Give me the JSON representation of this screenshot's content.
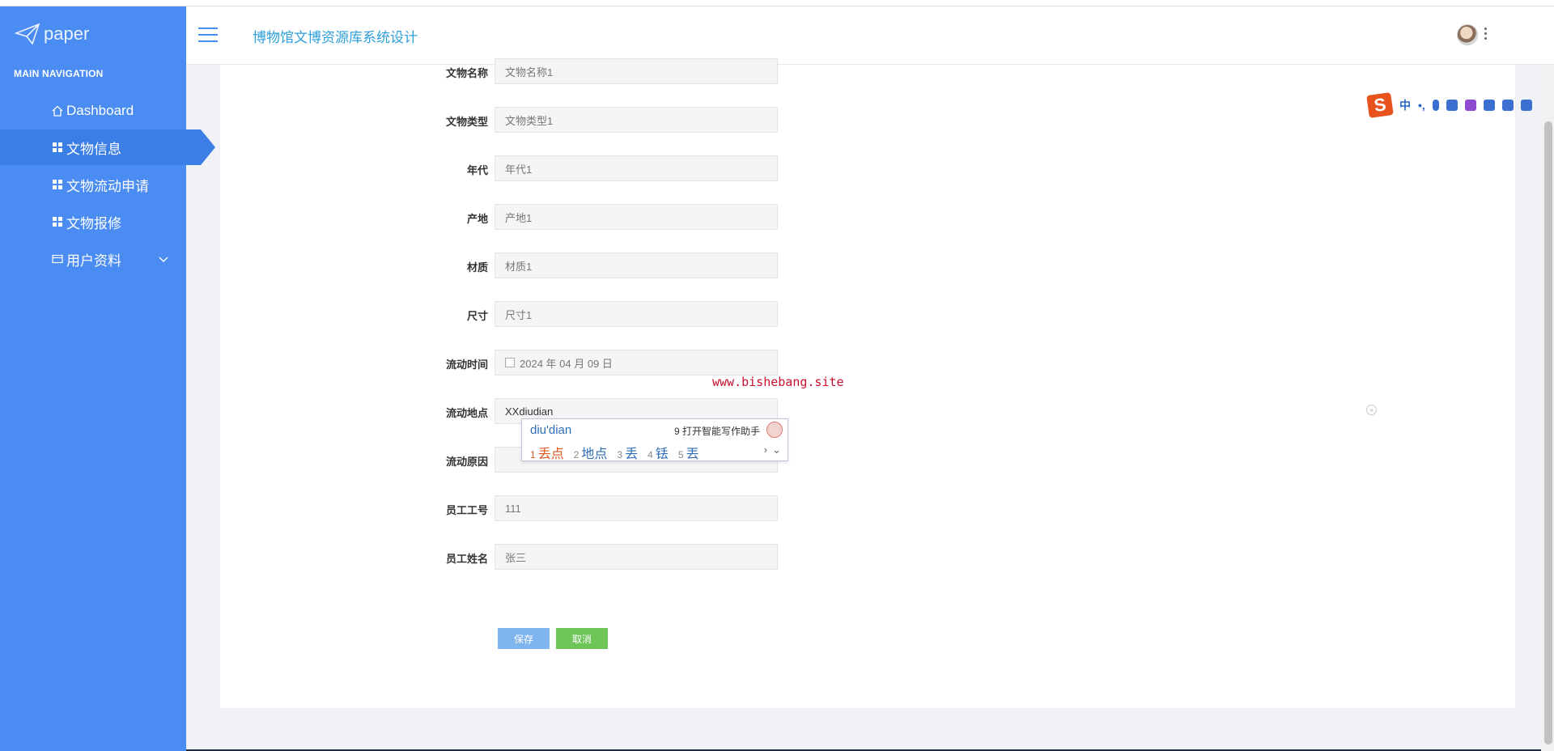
{
  "sidebar": {
    "brand": "paper",
    "heading": "MAIN NAVIGATION",
    "items": [
      {
        "label": "Dashboard",
        "icon": "home-icon"
      },
      {
        "label": "文物信息",
        "icon": "grid-icon",
        "active": true
      },
      {
        "label": "文物流动申请",
        "icon": "grid-icon"
      },
      {
        "label": "文物报修",
        "icon": "grid-icon"
      },
      {
        "label": "用户资料",
        "icon": "card-icon",
        "expandable": true
      }
    ]
  },
  "header": {
    "title": "博物馆文博资源库系统设计"
  },
  "form": {
    "fields": [
      {
        "label": "文物名称",
        "value": "文物名称1"
      },
      {
        "label": "文物类型",
        "value": "文物类型1"
      },
      {
        "label": "年代",
        "value": "年代1"
      },
      {
        "label": "产地",
        "value": "产地1"
      },
      {
        "label": "材质",
        "value": "材质1"
      },
      {
        "label": "尺寸",
        "value": "尺寸1"
      },
      {
        "label": "流动时间",
        "value": "2024 年 04 月 09 日"
      },
      {
        "label": "流动地点",
        "value": "XXdiudian"
      },
      {
        "label": "流动原因",
        "value": ""
      },
      {
        "label": "员工工号",
        "value": "111"
      },
      {
        "label": "员工姓名",
        "value": "张三"
      }
    ],
    "save_label": "保存",
    "cancel_label": "取消"
  },
  "watermark": "www.bishebang.site",
  "ime": {
    "pinyin": "diu'dian",
    "assist": "9 打开智能写作助手",
    "candidates": [
      {
        "n": "1",
        "text": "丢点"
      },
      {
        "n": "2",
        "text": "地点"
      },
      {
        "n": "3",
        "text": "丢"
      },
      {
        "n": "4",
        "text": "铥"
      },
      {
        "n": "5",
        "text": "丟"
      }
    ]
  },
  "sogou_toolbar": {
    "logo": "S",
    "mode": "中",
    "punct": "•,"
  },
  "colors": {
    "sidebar": "#4a8cf2",
    "sidebar_active": "#3b7ee6",
    "title": "#2d9fd9",
    "save": "#7fb5ef",
    "cancel": "#6fc45a",
    "watermark": "#c8102e"
  }
}
